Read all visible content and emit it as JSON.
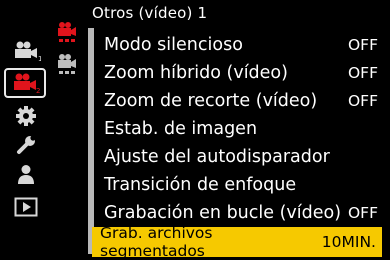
{
  "header": {
    "title": "Otros (vídeo) 1"
  },
  "sidebar": {
    "items": [
      {
        "icon": "video-camera-1-icon",
        "badge": "1",
        "active": false
      },
      {
        "icon": "video-camera-2-icon",
        "badge": "2",
        "active": true
      },
      {
        "icon": "gear-icon",
        "active": false
      },
      {
        "icon": "wrench-icon",
        "active": false
      },
      {
        "icon": "person-icon",
        "active": false
      },
      {
        "icon": "playback-icon",
        "active": false
      }
    ]
  },
  "sub_tabs": [
    {
      "icon": "red-camera-tab-icon",
      "active": true
    },
    {
      "icon": "gray-camera-tab-icon",
      "active": false
    }
  ],
  "menu": {
    "items": [
      {
        "label": "Modo silencioso",
        "value": "OFF"
      },
      {
        "label": "Zoom híbrido (vídeo)",
        "value": "OFF"
      },
      {
        "label": "Zoom de recorte (vídeo)",
        "value": "OFF"
      },
      {
        "label": "Estab. de imagen",
        "value": ""
      },
      {
        "label": "Ajuste del autodisparador",
        "value": ""
      },
      {
        "label": "Transición de enfoque",
        "value": ""
      },
      {
        "label": "Grabación en bucle (vídeo)",
        "value": "OFF"
      },
      {
        "label": "Grab. archivos segmentados",
        "value": "10MIN.",
        "selected": true
      }
    ]
  },
  "colors": {
    "highlight": "#f6c900",
    "active_red": "#e0141c",
    "icon_gray": "#d8d8d8"
  }
}
